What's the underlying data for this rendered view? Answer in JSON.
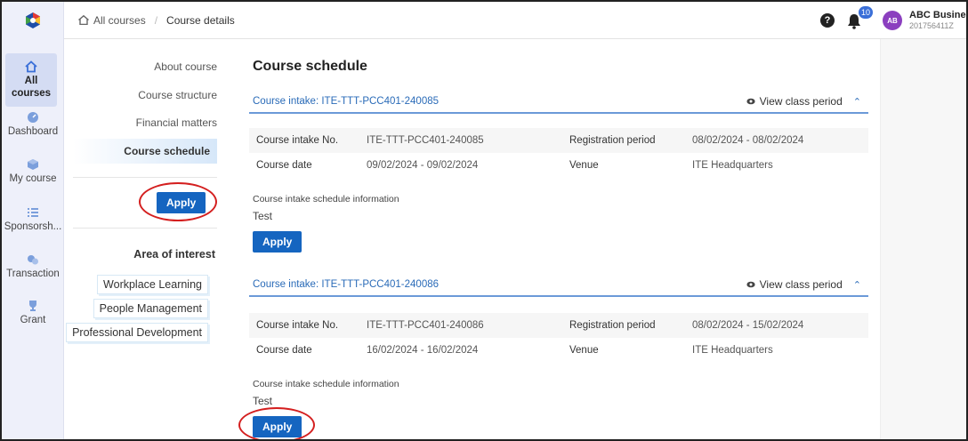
{
  "rail": {
    "items": [
      {
        "label": "All courses",
        "icon": "home-icon",
        "active": true
      },
      {
        "label": "Dashboard",
        "icon": "dashboard-icon"
      },
      {
        "label": "My course",
        "icon": "cube-icon"
      },
      {
        "label": "Sponsorsh...",
        "icon": "list-icon"
      },
      {
        "label": "Transaction",
        "icon": "coins-icon"
      },
      {
        "label": "Grant",
        "icon": "trophy-icon"
      }
    ]
  },
  "breadcrumb": {
    "home": "All courses",
    "current": "Course details"
  },
  "header": {
    "notification_count": "10",
    "avatar_initials": "AB",
    "user_name": "ABC Business",
    "user_id": "201756411Z"
  },
  "subnav": {
    "items": [
      "About course",
      "Course structure",
      "Financial matters"
    ],
    "active": "Course schedule",
    "apply_label": "Apply",
    "aoi_title": "Area of interest",
    "aoi": [
      "Workplace Learning",
      "People Management",
      "Professional Development"
    ]
  },
  "main": {
    "title": "Course schedule",
    "view_period_label": "View class period",
    "intakes": [
      {
        "title": "Course intake: ITE-TTT-PCC401-240085",
        "intake_no_label": "Course intake No.",
        "intake_no": "ITE-TTT-PCC401-240085",
        "reg_label": "Registration period",
        "reg_value": "08/02/2024 - 08/02/2024",
        "date_label": "Course date",
        "date_value": "09/02/2024 - 09/02/2024",
        "venue_label": "Venue",
        "venue_value": "ITE Headquarters",
        "sched_label": "Course intake schedule information",
        "sched_value": "Test",
        "apply_label": "Apply"
      },
      {
        "title": "Course intake: ITE-TTT-PCC401-240086",
        "intake_no_label": "Course intake No.",
        "intake_no": "ITE-TTT-PCC401-240086",
        "reg_label": "Registration period",
        "reg_value": "08/02/2024 - 15/02/2024",
        "date_label": "Course date",
        "date_value": "16/02/2024 - 16/02/2024",
        "venue_label": "Venue",
        "venue_value": "ITE Headquarters",
        "sched_label": "Course intake schedule information",
        "sched_value": "Test",
        "apply_label": "Apply"
      }
    ]
  },
  "colors": {
    "accent": "#1565c0",
    "link": "#2a6bb8",
    "annotation": "#d41f1f",
    "rail_bg": "#eef0fa"
  }
}
